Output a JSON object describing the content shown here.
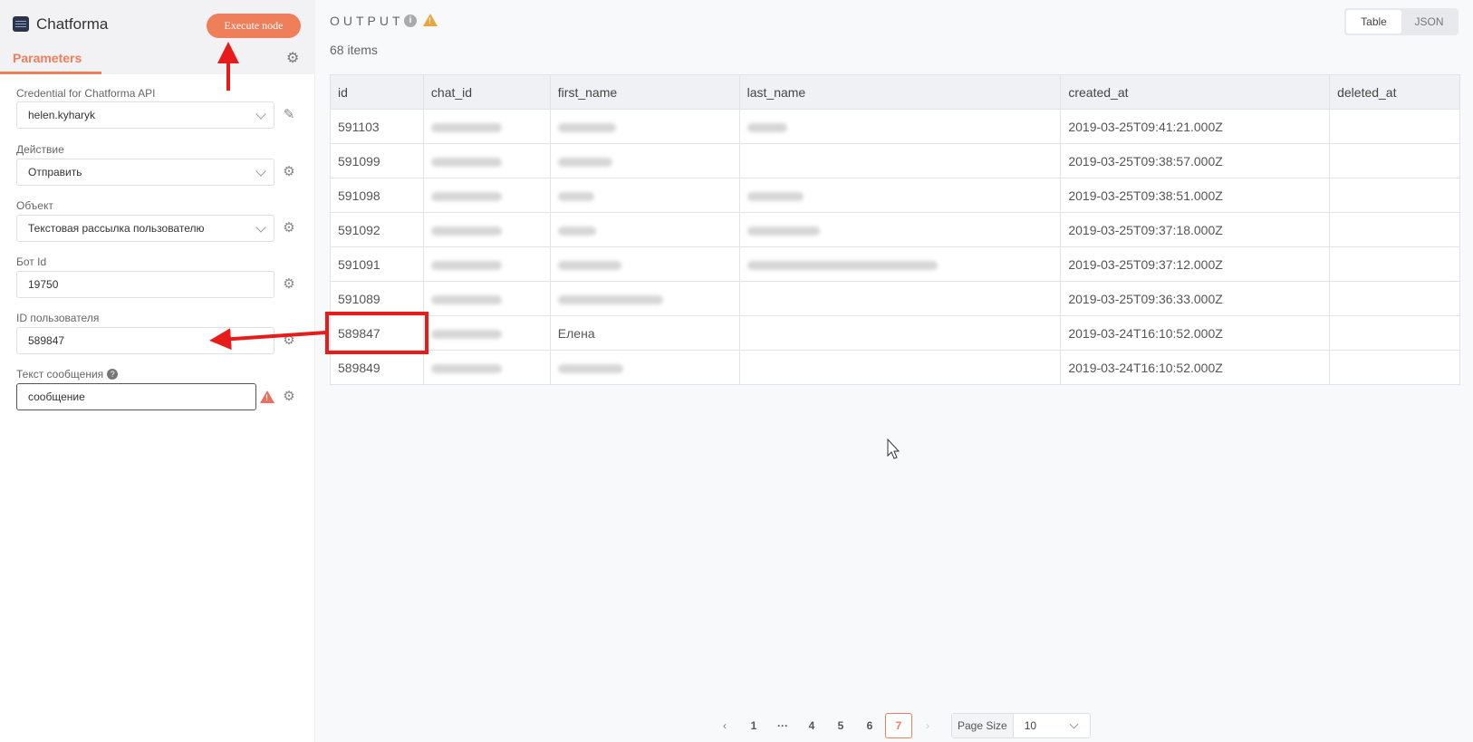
{
  "node": {
    "title": "Chatforma",
    "execute_label": "Execute node",
    "tab_parameters": "Parameters"
  },
  "fields": {
    "credential": {
      "label": "Credential for Chatforma API",
      "value": "helen.kyharyk"
    },
    "action": {
      "label": "Действие",
      "value": "Отправить"
    },
    "object": {
      "label": "Объект",
      "value": "Текстовая рассылка пользователю"
    },
    "bot_id": {
      "label": "Бот Id",
      "value": "19750"
    },
    "user_id": {
      "label": "ID пользователя",
      "value": "589847"
    },
    "message": {
      "label": "Текст сообщения",
      "value": "сообщение"
    }
  },
  "output": {
    "title": "OUTPUT",
    "items_count": "68 items",
    "view_table": "Table",
    "view_json": "JSON",
    "columns": [
      "id",
      "chat_id",
      "first_name",
      "last_name",
      "created_at",
      "deleted_at"
    ],
    "rows": [
      {
        "id": "591103",
        "first_name": "",
        "created_at": "2019-03-25T09:41:21.000Z"
      },
      {
        "id": "591099",
        "first_name": "",
        "created_at": "2019-03-25T09:38:57.000Z"
      },
      {
        "id": "591098",
        "first_name": "",
        "created_at": "2019-03-25T09:38:51.000Z"
      },
      {
        "id": "591092",
        "first_name": "",
        "created_at": "2019-03-25T09:37:18.000Z"
      },
      {
        "id": "591091",
        "first_name": "",
        "created_at": "2019-03-25T09:37:12.000Z"
      },
      {
        "id": "591089",
        "first_name": "",
        "created_at": "2019-03-25T09:36:33.000Z"
      },
      {
        "id": "589847",
        "first_name": "Елена",
        "created_at": "2019-03-24T16:10:52.000Z"
      },
      {
        "id": "589849",
        "first_name": "",
        "created_at": "2019-03-24T16:10:52.000Z"
      }
    ]
  },
  "pagination": {
    "pages": [
      "1",
      "···",
      "4",
      "5",
      "6",
      "7"
    ],
    "current": "7",
    "page_size_label": "Page Size",
    "page_size_value": "10"
  },
  "colors": {
    "accent": "#ef7e5b",
    "annotation": "#e81b1b",
    "warning": "#f0a23a"
  }
}
